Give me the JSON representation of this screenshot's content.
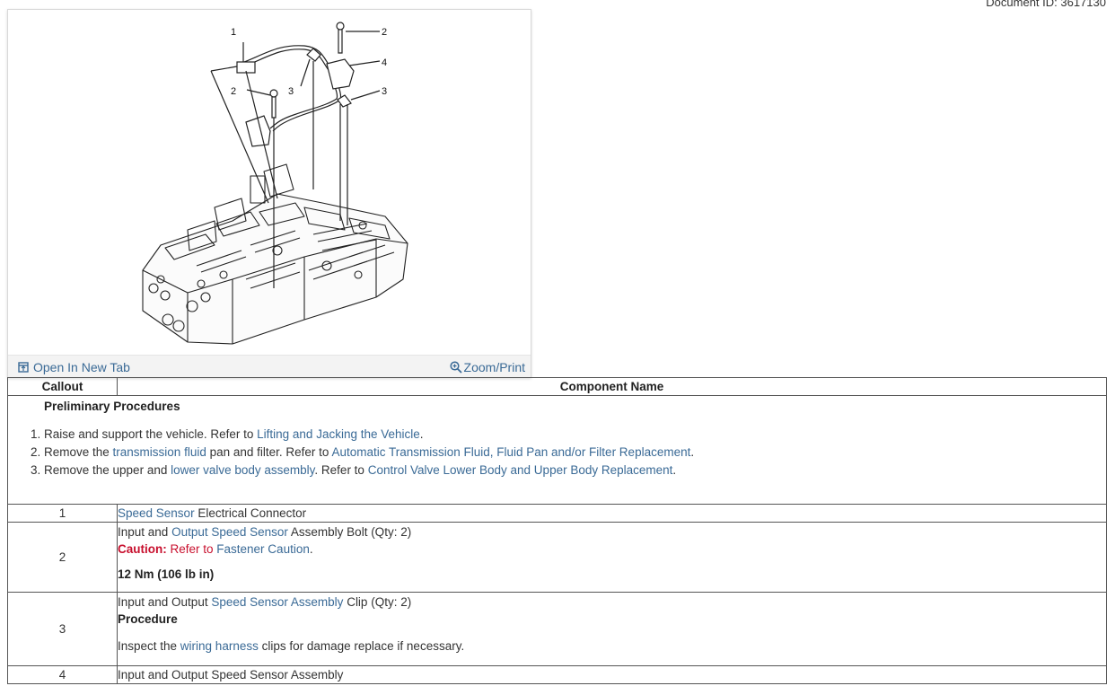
{
  "header": {
    "document_id": "Document ID: 3617130"
  },
  "figure": {
    "open_new_tab": "Open In New Tab",
    "zoom_print": "Zoom/Print",
    "callouts": {
      "c1": "1",
      "c2a": "2",
      "c2b": "2",
      "c3a": "3",
      "c3b": "3",
      "c4": "4"
    }
  },
  "table": {
    "headers": {
      "callout": "Callout",
      "component": "Component Name"
    },
    "preliminary": {
      "title": "Preliminary Procedures",
      "step1": {
        "text": "Raise and support the vehicle. Refer to ",
        "link": "Lifting and Jacking the Vehicle",
        "end": "."
      },
      "step2": {
        "text_a": "Remove the ",
        "link_a": "transmission fluid",
        "text_b": " pan and filter. Refer to ",
        "link_b": "Automatic Transmission Fluid, Fluid Pan and/or Filter Replacement",
        "end": "."
      },
      "step3": {
        "text_a": "Remove the upper and ",
        "link_a": "lower valve body assembly",
        "text_b": ". Refer to ",
        "link_b": "Control Valve Lower Body and Upper Body Replacement",
        "end": "."
      }
    },
    "rows": [
      {
        "callout": "1",
        "link": "Speed Sensor",
        "text": " Electrical Connector"
      },
      {
        "callout": "2",
        "text_a": "Input and ",
        "link": "Output Speed Sensor",
        "text_b": " Assembly Bolt (Qty: 2)",
        "caution_label": "Caution:",
        "caution_text": " Refer to ",
        "caution_link": "Fastener Caution",
        "caution_end": ".",
        "torque": "12 Nm (106 lb in)"
      },
      {
        "callout": "3",
        "text_a": "Input and Output ",
        "link": "Speed Sensor Assembly",
        "text_b": " Clip (Qty: 2)",
        "procedure": "Procedure",
        "inspect_a": "Inspect the ",
        "inspect_link": "wiring harness",
        "inspect_b": " clips for damage replace if necessary."
      },
      {
        "callout": "4",
        "text": "Input and Output Speed Sensor Assembly"
      }
    ]
  }
}
